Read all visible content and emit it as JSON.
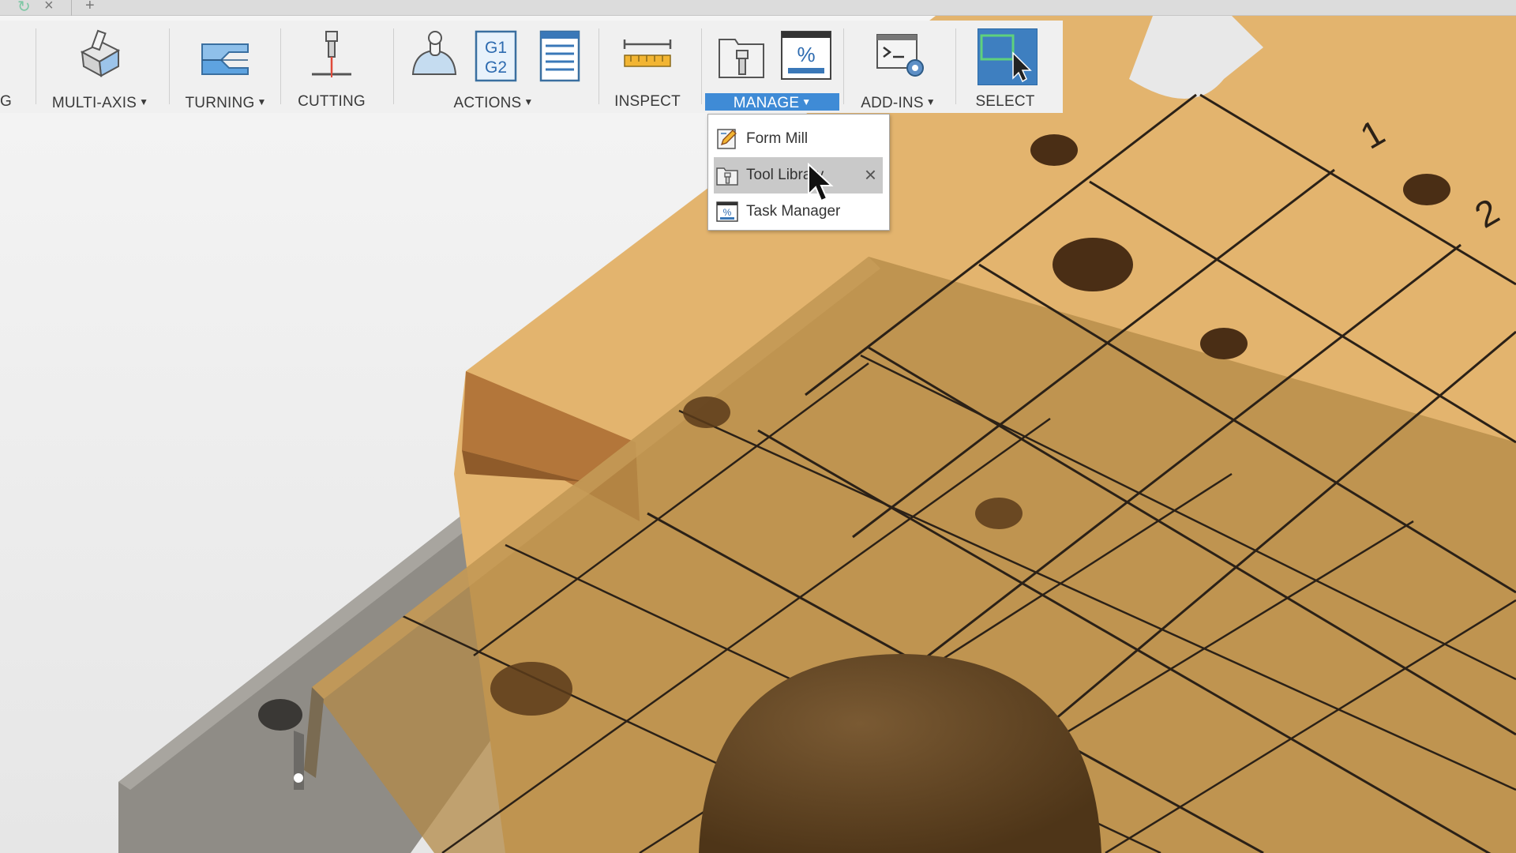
{
  "title_strip": {
    "icons": [
      "refresh-icon",
      "close-icon",
      "add-icon"
    ]
  },
  "toolbar": {
    "groups": [
      {
        "label": "G",
        "has_caret": false
      },
      {
        "label": "MULTI-AXIS",
        "has_caret": true,
        "icons": [
          "multi-axis-icon"
        ]
      },
      {
        "label": "TURNING",
        "has_caret": true,
        "icons": [
          "turning-icon"
        ]
      },
      {
        "label": "CUTTING",
        "has_caret": false,
        "icons": [
          "cutting-icon"
        ]
      },
      {
        "label": "ACTIONS",
        "has_caret": true,
        "icons": [
          "simulate-icon",
          "post-process-icon",
          "setup-sheet-icon"
        ]
      },
      {
        "label": "INSPECT",
        "has_caret": false,
        "icons": [
          "measure-icon"
        ]
      },
      {
        "label": "MANAGE",
        "has_caret": true,
        "active": true,
        "icons": [
          "tool-library-icon",
          "task-manager-icon"
        ]
      },
      {
        "label": "ADD-INS",
        "has_caret": true,
        "icons": [
          "scripts-addins-icon"
        ]
      },
      {
        "label": "SELECT",
        "has_caret": false,
        "icons": [
          "select-icon"
        ]
      }
    ],
    "g1g2_text": [
      "G1",
      "G2"
    ],
    "task_manager_symbol": "%"
  },
  "manage_menu": {
    "items": [
      {
        "label": "Form Mill",
        "icon": "form-mill-icon"
      },
      {
        "label": "Tool Library",
        "icon": "tool-library-icon",
        "hovered": true,
        "pin_icon": "close-icon"
      },
      {
        "label": "Task Manager",
        "icon": "task-manager-icon"
      }
    ]
  },
  "viewport": {
    "grid_labels": [
      "1",
      "2"
    ]
  },
  "colors": {
    "toolbar_bg": "#f0f0f0",
    "active_tab": "#3f8bd6",
    "select_button": "#3e7fc0",
    "wood": "#e0b069",
    "fixture": "#9d9a93"
  }
}
